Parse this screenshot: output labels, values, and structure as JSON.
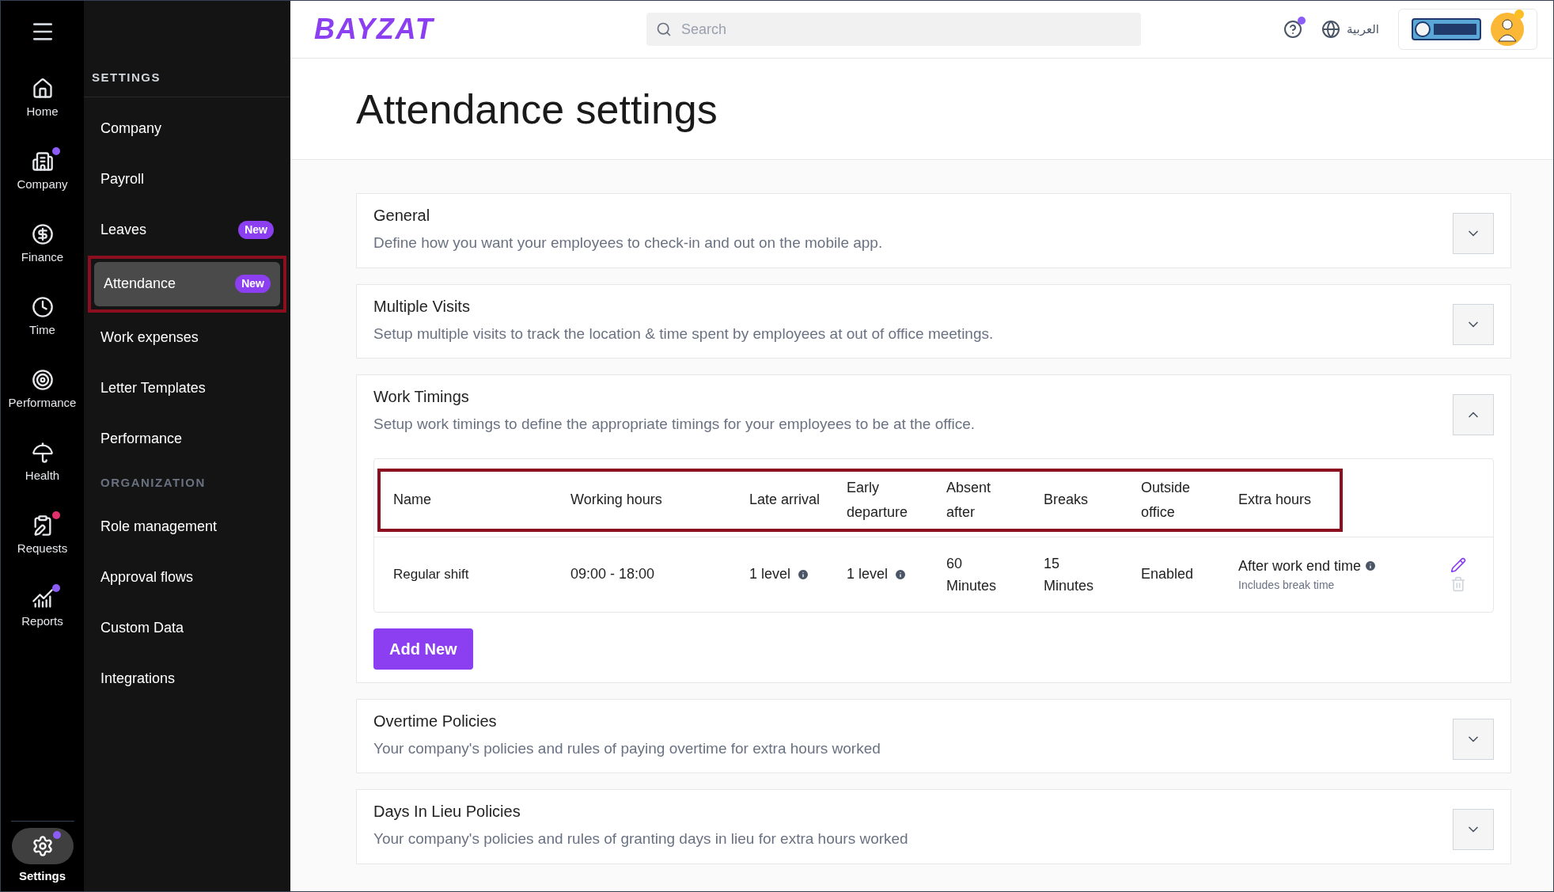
{
  "rail": {
    "items": [
      {
        "label": "Home",
        "notification": false,
        "selected": false
      },
      {
        "label": "Company",
        "notification": true,
        "selected": false
      },
      {
        "label": "Finance",
        "notification": false,
        "selected": false
      },
      {
        "label": "Time",
        "notification": false,
        "selected": false
      },
      {
        "label": "Performance",
        "notification": false,
        "selected": false
      },
      {
        "label": "Health",
        "notification": false,
        "selected": false
      },
      {
        "label": "Requests",
        "notification": true,
        "selected": false
      },
      {
        "label": "Reports",
        "notification": true,
        "selected": false
      }
    ],
    "settings": {
      "label": "Settings",
      "notification": true,
      "selected": true
    }
  },
  "sidebar": {
    "sections": [
      {
        "heading": "SETTINGS",
        "items": [
          {
            "label": "Company",
            "selected": false
          },
          {
            "label": "Payroll",
            "selected": false
          },
          {
            "label": "Leaves",
            "badge": "New",
            "selected": false
          },
          {
            "label": "Attendance",
            "badge": "New",
            "selected": true,
            "highlighted": true
          },
          {
            "label": "Work expenses",
            "selected": false
          },
          {
            "label": "Letter Templates",
            "selected": false
          },
          {
            "label": "Performance",
            "selected": false
          }
        ]
      },
      {
        "heading": "ORGANIZATION",
        "items": [
          {
            "label": "Role management",
            "selected": false
          },
          {
            "label": "Approval flows",
            "selected": false
          },
          {
            "label": "Custom Data",
            "selected": false
          },
          {
            "label": "Integrations",
            "selected": false
          }
        ]
      }
    ]
  },
  "header": {
    "logo": "BAYZAT",
    "search": {
      "placeholder": "Search"
    },
    "help_notification": true,
    "language": "العربية",
    "avatar_status": true
  },
  "page": {
    "title": "Attendance settings"
  },
  "sections": [
    {
      "title": "General",
      "description": "Define how you want your employees to check-in and out on the mobile app.",
      "expanded": false
    },
    {
      "title": "Multiple Visits",
      "description": "Setup multiple visits to track the location & time spent by employees at out of office meetings.",
      "expanded": false
    },
    {
      "title": "Work Timings",
      "description": "Setup work timings to define the appropriate timings for your employees to be at the office.",
      "expanded": true,
      "table": {
        "highlighted": true,
        "columns": [
          "Name",
          "Working hours",
          "Late arrival",
          "Early departure",
          "Absent after",
          "Breaks",
          "Outside office",
          "Extra hours"
        ],
        "rows": [
          {
            "name": "Regular shift",
            "working_hours": "09:00 - 18:00",
            "late_arrival": "1 level",
            "early_departure": "1 level",
            "absent_after": "60 Minutes",
            "breaks": "15 Minutes",
            "outside_office": "Enabled",
            "extra_hours": "After work end time",
            "extra_hours_note": "Includes break time"
          }
        ]
      },
      "button": "Add New"
    },
    {
      "title": "Overtime Policies",
      "description": "Your company's policies and rules of paying overtime for extra hours worked",
      "expanded": false
    },
    {
      "title": "Days In Lieu Policies",
      "description": "Your company's policies and rules of granting days in lieu for extra hours worked",
      "expanded": false
    }
  ]
}
